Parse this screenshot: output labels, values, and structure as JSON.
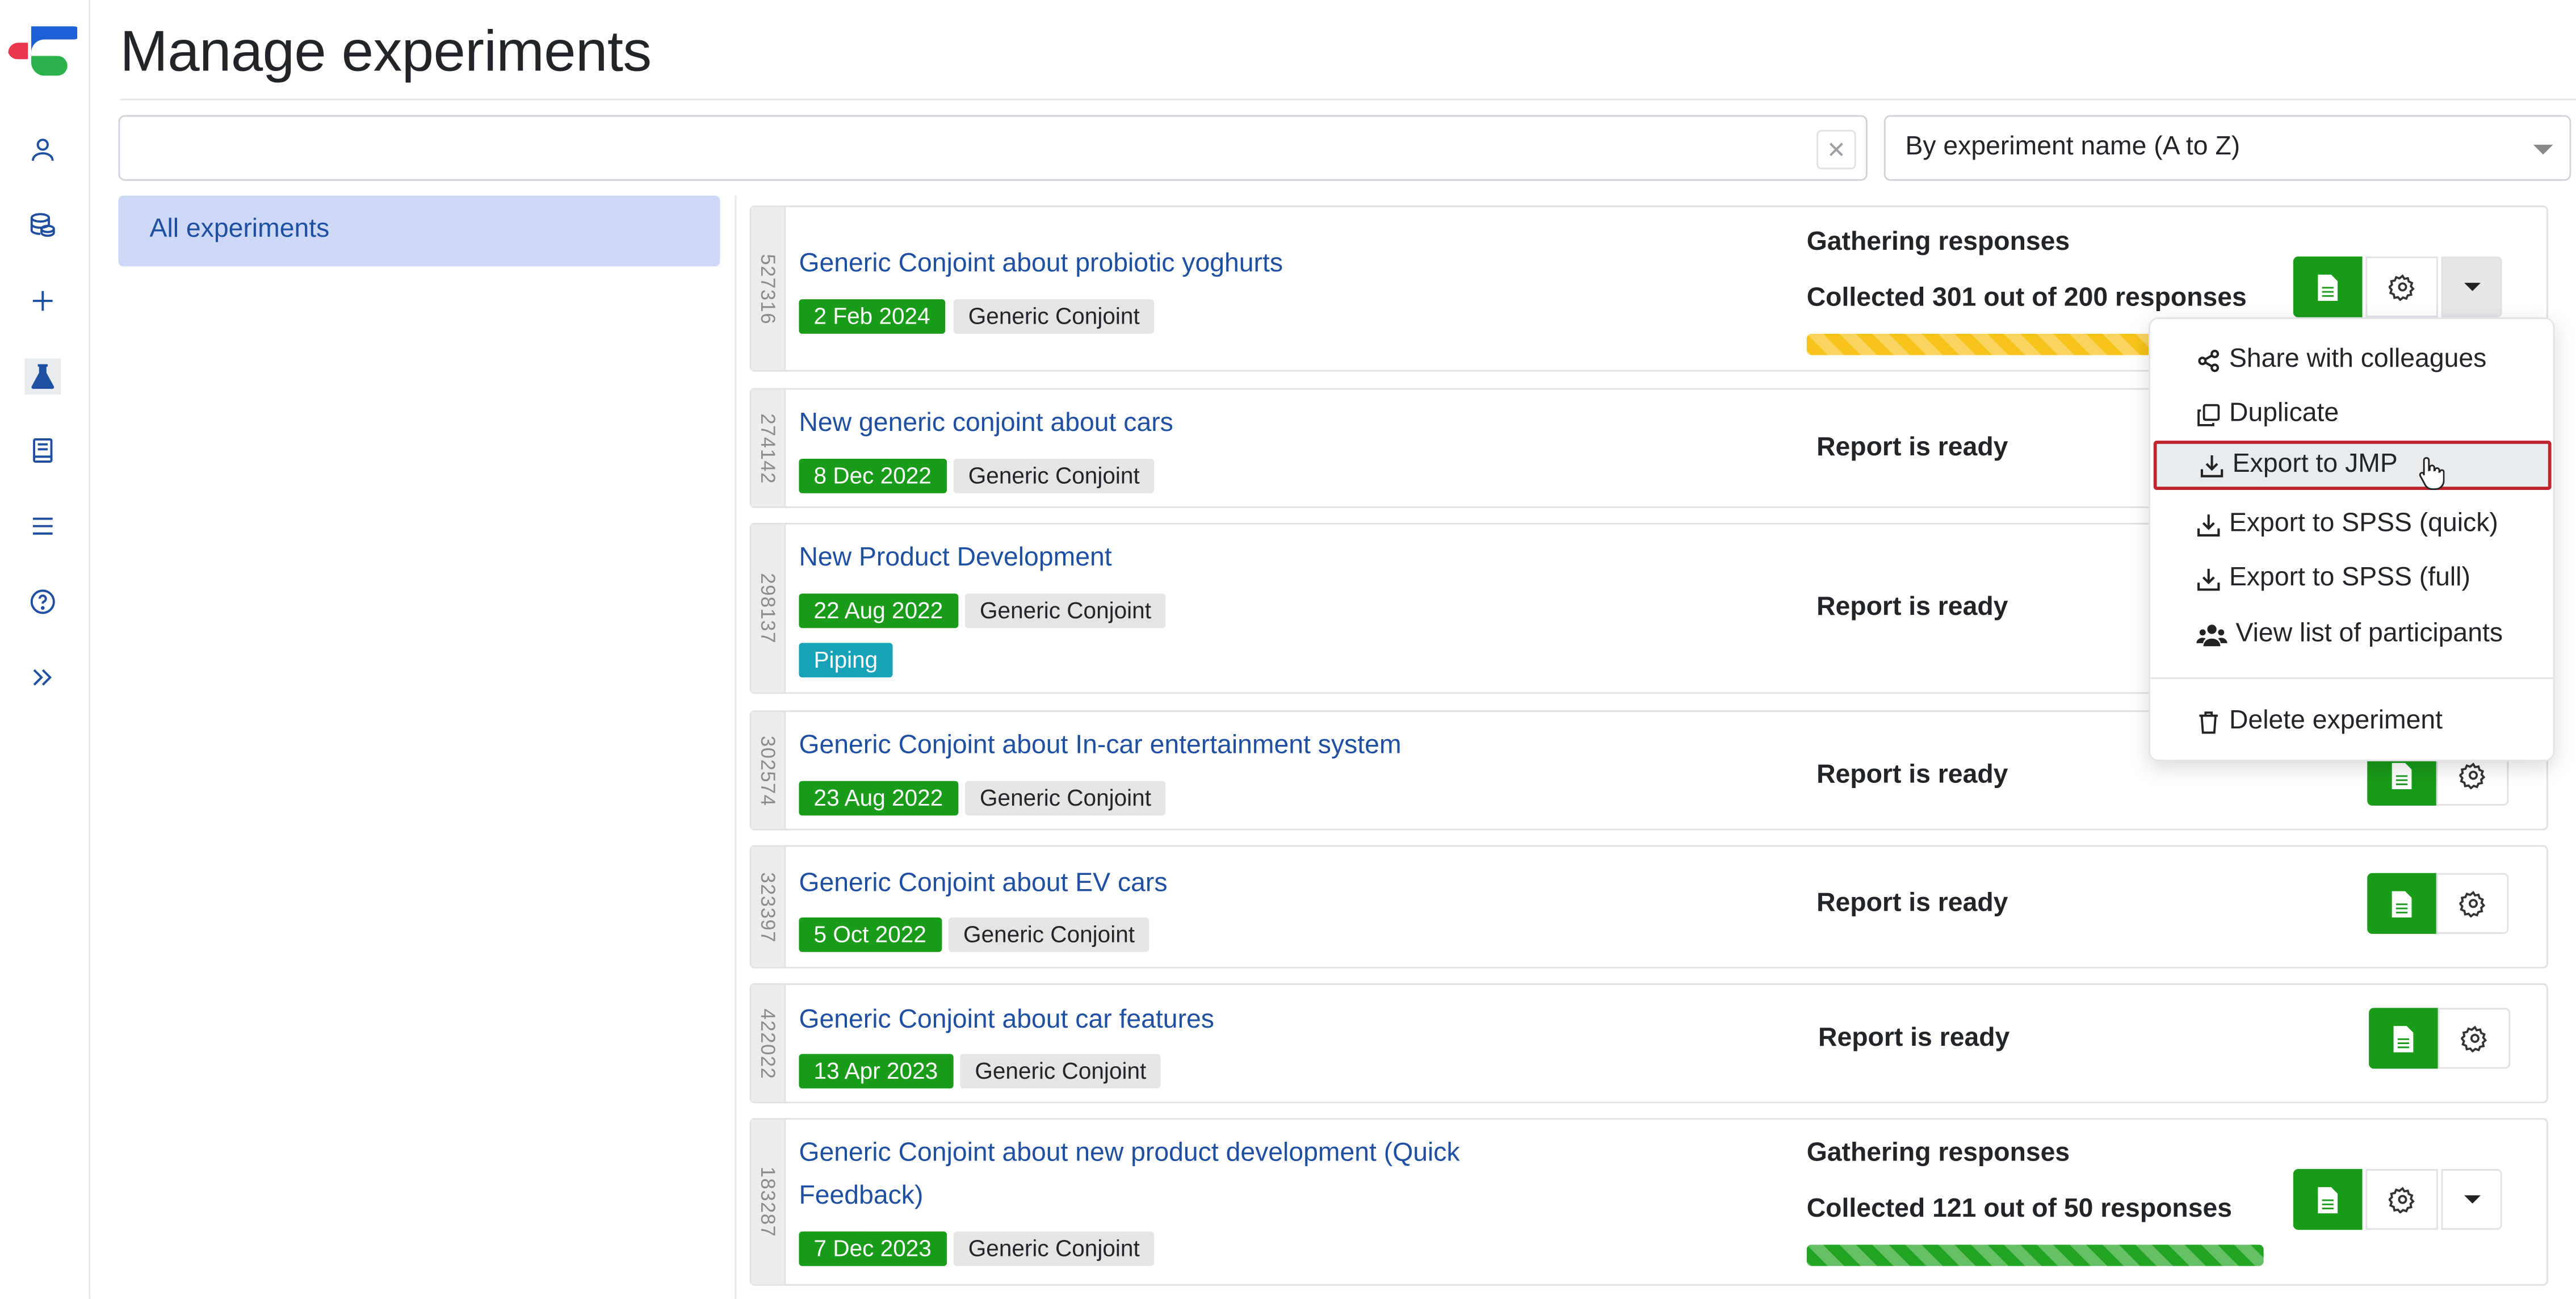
{
  "page": {
    "title": "Manage experiments"
  },
  "search": {
    "value": "",
    "placeholder": "",
    "clear_icon": "x-icon"
  },
  "sort": {
    "selected": "By experiment name (A to Z)"
  },
  "categories": {
    "items": [
      {
        "label": "All experiments",
        "selected": true
      }
    ]
  },
  "sidebar": {
    "items": [
      {
        "name": "user-icon"
      },
      {
        "name": "database-icon"
      },
      {
        "name": "plus-icon"
      },
      {
        "name": "flask-icon",
        "active": true
      },
      {
        "name": "book-icon"
      },
      {
        "name": "menu-icon"
      },
      {
        "name": "help-icon"
      },
      {
        "name": "expand-icon"
      }
    ]
  },
  "experiments": [
    {
      "id": "527316",
      "title": "Generic Conjoint about probiotic yoghurts",
      "date": "2 Feb 2024",
      "type": "Generic Conjoint",
      "status": "Gathering responses",
      "collected": "Collected 301 out of 200 responses",
      "progress": 1.0,
      "progress_color": "#f7c31a",
      "menu_open": true
    },
    {
      "id": "274142",
      "title": "New generic conjoint about cars",
      "date": "8 Dec 2022",
      "type": "Generic Conjoint",
      "status": "Report is ready"
    },
    {
      "id": "298137",
      "title": "New Product Development",
      "date": "22 Aug 2022",
      "type": "Generic Conjoint",
      "extra_tag": "Piping",
      "status": "Report is ready"
    },
    {
      "id": "302574",
      "title": "Generic Conjoint about In-car entertainment system",
      "date": "23 Aug 2022",
      "type": "Generic Conjoint",
      "status": "Report is ready"
    },
    {
      "id": "323397",
      "title": "Generic Conjoint about EV cars",
      "date": "5 Oct 2022",
      "type": "Generic Conjoint",
      "status": "Report is ready"
    },
    {
      "id": "422022",
      "title": "Generic Conjoint about car features",
      "date": "13 Apr 2023",
      "type": "Generic Conjoint",
      "status": "Report is ready"
    },
    {
      "id": "183287",
      "title_line1": "Generic Conjoint about new product development (Quick",
      "title_line2": "Feedback)",
      "date": "7 Dec 2023",
      "type": "Generic Conjoint",
      "status": "Gathering responses",
      "collected": "Collected 121 out of 50 responses",
      "progress": 1.0,
      "progress_color": "#22a322"
    }
  ],
  "dropdown_menu": {
    "items": [
      {
        "label": "Share with colleagues",
        "icon": "share-icon"
      },
      {
        "label": "Duplicate",
        "icon": "duplicate-icon"
      },
      {
        "label": "Export to JMP",
        "icon": "download-icon",
        "active": true
      },
      {
        "label": "Export to SPSS (quick)",
        "icon": "download-icon"
      },
      {
        "label": "Export to SPSS (full)",
        "icon": "download-icon"
      },
      {
        "label": "View list of participants",
        "icon": "users-icon"
      },
      {
        "label": "Delete experiment",
        "icon": "trash-icon"
      }
    ]
  },
  "colors": {
    "accent": "#1f4fa1",
    "success": "#1a9b1a",
    "selected_bg": "#cdd9f6",
    "warning": "#f7c31a",
    "info": "#17a2b8",
    "highlight_border": "#c0242c"
  }
}
